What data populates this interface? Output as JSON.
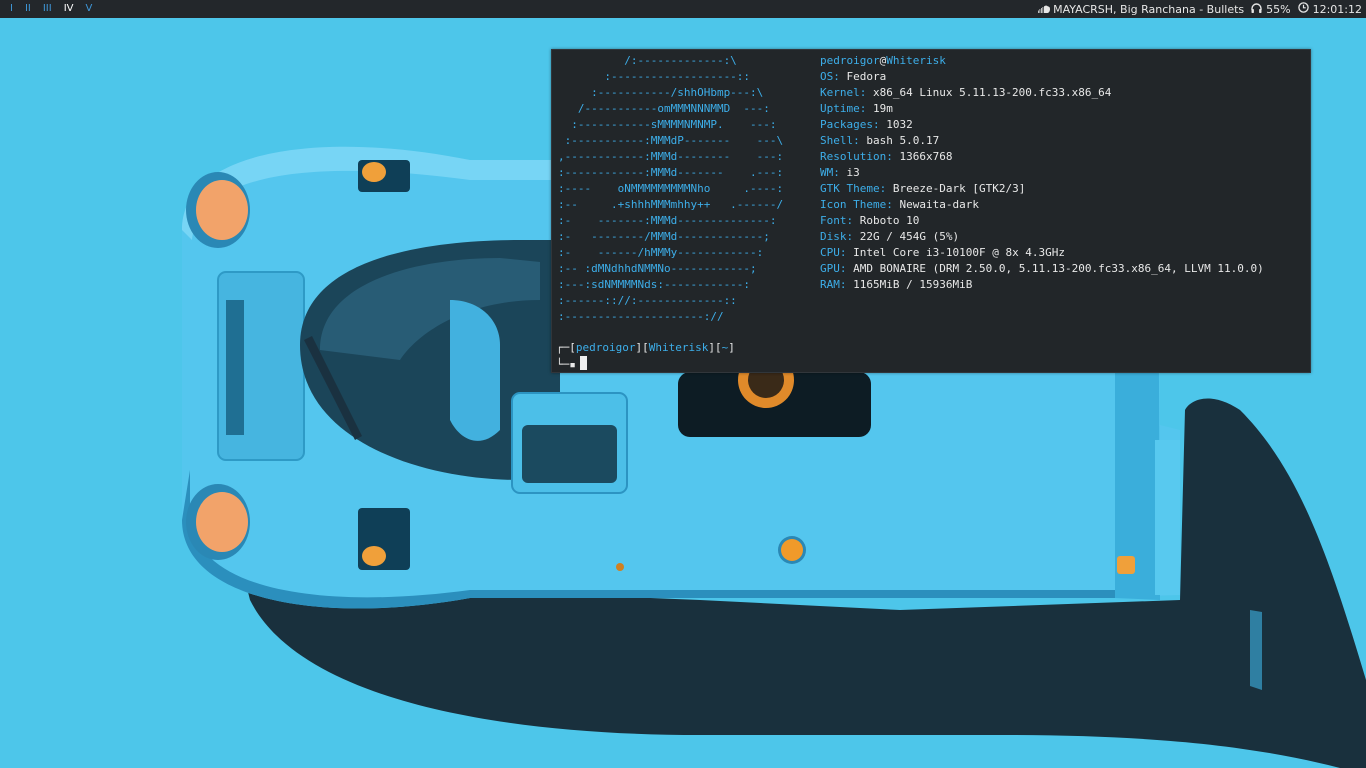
{
  "workspaces": [
    {
      "label": "I",
      "active": false
    },
    {
      "label": "II",
      "active": false
    },
    {
      "label": "III",
      "active": false
    },
    {
      "label": "IV",
      "active": true
    },
    {
      "label": "V",
      "active": false
    }
  ],
  "status": {
    "now_playing": "MAYACRSH, Big Ranchana - Bullets",
    "volume": "55%",
    "clock": "12:01:12",
    "icons": {
      "music": "soundcloud-icon",
      "volume": "headphones-icon",
      "clock": "clock-icon"
    }
  },
  "terminal": {
    "ascii_art": [
      "          /:-------------:\\",
      "       :-------------------::",
      "     :-----------/shhOHbmp---:\\",
      "   /-----------omMMMNNNMMD  ---:",
      "  :-----------sMMMMNMNMP.    ---:",
      " :-----------:MMMdP-------    ---\\",
      ",------------:MMMd--------    ---:",
      ":------------:MMMd-------    .---:",
      ":----    oNMMMMMMMMMNho     .----:",
      ":--     .+shhhMMMmhhy++   .------/",
      ":-    -------:MMMd--------------:",
      ":-   --------/MMMd-------------;",
      ":-    ------/hMMMy------------:",
      ":-- :dMNdhhdNMMNo------------;",
      ":---:sdNMMMMNds:------------:",
      ":------:://:-------------::",
      ":---------------------://"
    ],
    "header_user": "pedroigor",
    "header_at": "@",
    "header_host": "Whiterisk",
    "info": [
      {
        "key": "OS:",
        "value": "Fedora"
      },
      {
        "key": "Kernel:",
        "value": "x86_64 Linux 5.11.13-200.fc33.x86_64"
      },
      {
        "key": "Uptime:",
        "value": "19m"
      },
      {
        "key": "Packages:",
        "value": "1032"
      },
      {
        "key": "Shell:",
        "value": "bash 5.0.17"
      },
      {
        "key": "Resolution:",
        "value": "1366x768"
      },
      {
        "key": "WM:",
        "value": "i3"
      },
      {
        "key": "GTK Theme:",
        "value": "Breeze-Dark [GTK2/3]"
      },
      {
        "key": "Icon Theme:",
        "value": "Newaita-dark"
      },
      {
        "key": "Font:",
        "value": "Roboto 10"
      },
      {
        "key": "Disk:",
        "value": "22G / 454G (5%)"
      },
      {
        "key": "CPU:",
        "value": "Intel Core i3-10100F @ 8x 4.3GHz"
      },
      {
        "key": "GPU:",
        "value": "AMD BONAIRE (DRM 2.50.0, 5.11.13-200.fc33.x86_64, LLVM 11.0.0)"
      },
      {
        "key": "RAM:",
        "value": "1165MiB / 15936MiB"
      }
    ],
    "prompt": {
      "corner_top": "┌─",
      "corner_bottom": "└─",
      "user": "pedroigor",
      "host": "Whiterisk",
      "dir": "~",
      "symbol": "▪"
    }
  },
  "colors": {
    "wallpaper_bg": "#4dc6ea",
    "accent": "#3daee9",
    "terminal_bg": "#222629",
    "bar_bg": "#23272b"
  }
}
